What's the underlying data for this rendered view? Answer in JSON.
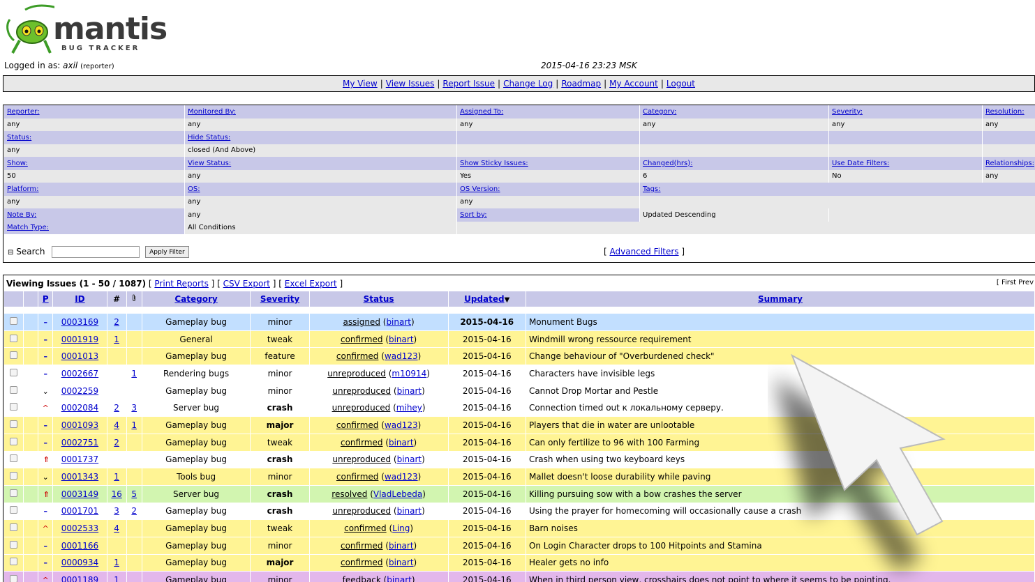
{
  "logo": {
    "name": "mantis",
    "sub": "BUG TRACKER"
  },
  "login": {
    "prefix": "Logged in as:",
    "user": "axil",
    "role": "(reporter)"
  },
  "datetime": "2015-04-16 23:23 MSK",
  "menu": [
    "My View",
    "View Issues",
    "Report Issue",
    "Change Log",
    "Roadmap",
    "My Account",
    "Logout"
  ],
  "filter": {
    "reporter": {
      "label": "Reporter:",
      "value": "any"
    },
    "monitored_by": {
      "label": "Monitored By:",
      "value": "any"
    },
    "assigned_to": {
      "label": "Assigned To:",
      "value": "any"
    },
    "category": {
      "label": "Category:",
      "value": "any"
    },
    "severity": {
      "label": "Severity:",
      "value": "any"
    },
    "resolution": {
      "label": "Resolution:",
      "value": "any"
    },
    "status": {
      "label": "Status:",
      "value": "any"
    },
    "hide_status": {
      "label": "Hide Status:",
      "value": "closed (And Above)"
    },
    "show": {
      "label": "Show:",
      "value": "50"
    },
    "view_status": {
      "label": "View Status:",
      "value": "any"
    },
    "show_sticky": {
      "label": "Show Sticky Issues:",
      "value": "Yes"
    },
    "changed": {
      "label": "Changed(hrs):",
      "value": "6"
    },
    "use_date": {
      "label": "Use Date Filters:",
      "value": "No"
    },
    "relationships": {
      "label": "Relationships:",
      "value": "any"
    },
    "platform": {
      "label": "Platform:",
      "value": "any"
    },
    "os": {
      "label": "OS:",
      "value": "any"
    },
    "os_version": {
      "label": "OS Version:",
      "value": "any"
    },
    "tags": {
      "label": "Tags:",
      "value": ""
    },
    "note_by": {
      "label": "Note By:",
      "value": "any"
    },
    "note_by_val": "any",
    "sort_by": {
      "label": "Sort by:",
      "value": "Updated Descending"
    },
    "match_type": {
      "label": "Match Type:",
      "value": "All Conditions"
    },
    "search_label": "Search",
    "search_value": "",
    "apply_label": "Apply Filter",
    "advanced_label": "Advanced Filters"
  },
  "issues": {
    "viewing": "Viewing Issues (1 - 50 / 1087)",
    "links": [
      "Print Reports",
      "CSV Export",
      "Excel Export"
    ],
    "paging": "[ First Prev",
    "headers": {
      "p": "P",
      "id": "ID",
      "notes": "#",
      "category": "Category",
      "severity": "Severity",
      "status": "Status",
      "updated": "Updated",
      "summary": "Summary"
    },
    "colors": {
      "assigned": "#c2dfff",
      "confirmed": "#fff494",
      "unreproduced": "#ffffff",
      "resolved": "#d2f5b0",
      "feedback": "#e3b7eb"
    },
    "rows": [
      {
        "pri": "normal",
        "id": "0003169",
        "notes": "2",
        "att": "",
        "category": "Gameplay bug",
        "severity": "minor",
        "sevbold": false,
        "status": "assigned",
        "handler": "binart",
        "updated": "2015-04-16",
        "updbold": true,
        "summary": "Monument Bugs",
        "color": "#c2dfff"
      },
      {
        "pri": "normal",
        "id": "0001919",
        "notes": "1",
        "att": "",
        "category": "General",
        "severity": "tweak",
        "sevbold": false,
        "status": "confirmed",
        "handler": "binart",
        "updated": "2015-04-16",
        "updbold": false,
        "summary": "Windmill wrong ressource requirement",
        "color": "#fff494"
      },
      {
        "pri": "normal",
        "id": "0001013",
        "notes": "",
        "att": "",
        "category": "Gameplay bug",
        "severity": "feature",
        "sevbold": false,
        "status": "confirmed",
        "handler": "wad123",
        "updated": "2015-04-16",
        "updbold": false,
        "summary": "Change behaviour of \"Overburdened check\"",
        "color": "#fff494"
      },
      {
        "pri": "normal",
        "id": "0002667",
        "notes": "",
        "att": "1",
        "category": "Rendering bugs",
        "severity": "minor",
        "sevbold": false,
        "status": "unreproduced",
        "handler": "m10914",
        "updated": "2015-04-16",
        "updbold": false,
        "summary": "Characters have invisible legs",
        "color": "#ffffff"
      },
      {
        "pri": "low",
        "id": "0002259",
        "notes": "",
        "att": "",
        "category": "Gameplay bug",
        "severity": "minor",
        "sevbold": false,
        "status": "unreproduced",
        "handler": "binart",
        "updated": "2015-04-16",
        "updbold": false,
        "summary": "Cannot Drop Mortar and Pestle",
        "color": "#ffffff"
      },
      {
        "pri": "high",
        "id": "0002084",
        "notes": "2",
        "att": "3",
        "category": "Server bug",
        "severity": "crash",
        "sevbold": true,
        "status": "unreproduced",
        "handler": "mihey",
        "updated": "2015-04-16",
        "updbold": false,
        "summary": "Connection timed out к локальному серверу.",
        "color": "#ffffff"
      },
      {
        "pri": "normal",
        "id": "0001093",
        "notes": "4",
        "att": "1",
        "category": "Gameplay bug",
        "severity": "major",
        "sevbold": true,
        "status": "confirmed",
        "handler": "wad123",
        "updated": "2015-04-16",
        "updbold": false,
        "summary": "Players that die in water are unlootable",
        "color": "#fff494"
      },
      {
        "pri": "normal",
        "id": "0002751",
        "notes": "2",
        "att": "",
        "category": "Gameplay bug",
        "severity": "tweak",
        "sevbold": false,
        "status": "confirmed",
        "handler": "binart",
        "updated": "2015-04-16",
        "updbold": false,
        "summary": "Can only fertilize to 96 with 100 Farming",
        "color": "#fff494"
      },
      {
        "pri": "urgent",
        "id": "0001737",
        "notes": "",
        "att": "",
        "category": "Gameplay bug",
        "severity": "crash",
        "sevbold": true,
        "status": "unreproduced",
        "handler": "binart",
        "updated": "2015-04-16",
        "updbold": false,
        "summary": "Crash when using two keyboard keys",
        "color": "#ffffff"
      },
      {
        "pri": "low",
        "id": "0001343",
        "notes": "1",
        "att": "",
        "category": "Tools bug",
        "severity": "minor",
        "sevbold": false,
        "status": "confirmed",
        "handler": "wad123",
        "updated": "2015-04-16",
        "updbold": false,
        "summary": "Mallet doesn't loose durability while paving",
        "color": "#fff494"
      },
      {
        "pri": "urgent",
        "id": "0003149",
        "notes": "16",
        "att": "5",
        "category": "Server bug",
        "severity": "crash",
        "sevbold": true,
        "status": "resolved",
        "handler": "VladLebeda",
        "updated": "2015-04-16",
        "updbold": false,
        "summary": "Killing pursuing sow with a bow crashes the server",
        "color": "#d2f5b0"
      },
      {
        "pri": "normal",
        "id": "0001701",
        "notes": "3",
        "att": "2",
        "category": "Gameplay bug",
        "severity": "crash",
        "sevbold": true,
        "status": "unreproduced",
        "handler": "binart",
        "updated": "2015-04-16",
        "updbold": false,
        "summary": "Using the prayer for homecoming will occasionally cause a crash",
        "color": "#ffffff"
      },
      {
        "pri": "high",
        "id": "0002533",
        "notes": "4",
        "att": "",
        "category": "Gameplay bug",
        "severity": "tweak",
        "sevbold": false,
        "status": "confirmed",
        "handler": "Ling",
        "updated": "2015-04-16",
        "updbold": false,
        "summary": "Barn noises",
        "color": "#fff494"
      },
      {
        "pri": "normal",
        "id": "0001166",
        "notes": "",
        "att": "",
        "category": "Gameplay bug",
        "severity": "minor",
        "sevbold": false,
        "status": "confirmed",
        "handler": "binart",
        "updated": "2015-04-16",
        "updbold": false,
        "summary": "On Login Character drops to 100 Hitpoints and Stamina",
        "color": "#fff494"
      },
      {
        "pri": "normal",
        "id": "0000934",
        "notes": "1",
        "att": "",
        "category": "Gameplay bug",
        "severity": "major",
        "sevbold": true,
        "status": "confirmed",
        "handler": "binart",
        "updated": "2015-04-16",
        "updbold": false,
        "summary": "Healer gets no info",
        "color": "#fff494"
      },
      {
        "pri": "high",
        "id": "0001189",
        "notes": "1",
        "att": "",
        "category": "Gameplay bug",
        "severity": "minor",
        "sevbold": false,
        "status": "feedback",
        "handler": "binart",
        "updated": "2015-04-16",
        "updbold": false,
        "summary": "When in third person view, crosshairs does not point to where it seems to be pointing.",
        "color": "#e3b7eb"
      }
    ]
  }
}
